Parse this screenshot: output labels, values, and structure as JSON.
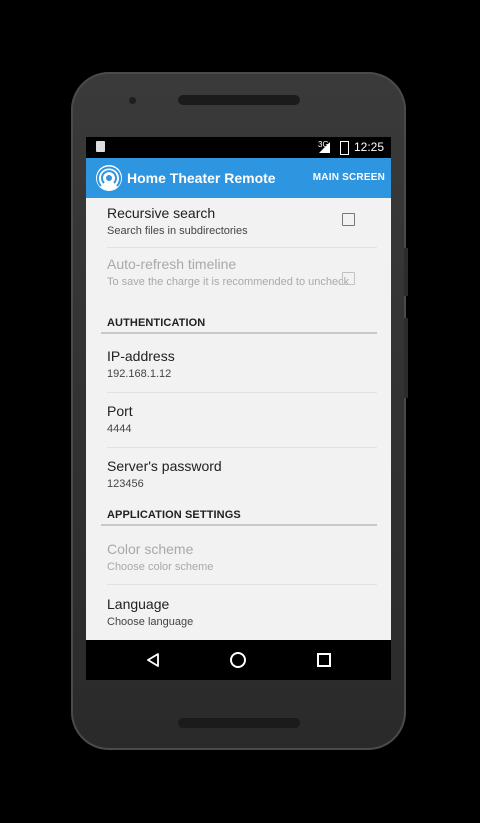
{
  "status_bar": {
    "signal": "3G",
    "time": "12:25"
  },
  "app_bar": {
    "title": "Home Theater Remote",
    "action": "MAIN SCREEN",
    "logo_icon": "broadcast-icon",
    "color": "#2e95e0"
  },
  "preferences": {
    "recursive": {
      "title": "Recursive search",
      "summary": "Search files in subdirectories",
      "checked": false
    },
    "autorefresh": {
      "title": "Auto-refresh timeline",
      "summary": "To save the charge it is recommended to uncheck",
      "checked": false,
      "enabled": false
    },
    "auth_header": "AUTHENTICATION",
    "ip": {
      "title": "IP-address",
      "value": "192.168.1.12"
    },
    "port": {
      "title": "Port",
      "value": "4444"
    },
    "password": {
      "title": "Server's password",
      "value": "123456"
    },
    "app_header": "APPLICATION SETTINGS",
    "color_scheme": {
      "title": "Color scheme",
      "summary": "Choose color scheme",
      "enabled": false
    },
    "language": {
      "title": "Language",
      "summary": "Choose language"
    }
  },
  "nav_bar": {
    "icons": [
      "back-icon",
      "home-icon",
      "recents-icon"
    ]
  }
}
